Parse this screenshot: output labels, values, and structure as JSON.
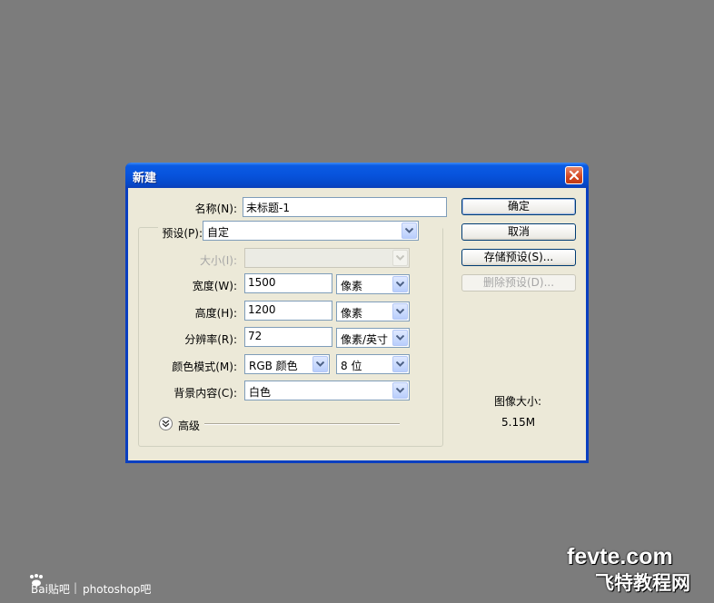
{
  "dialog": {
    "title": "新建",
    "close_icon": "close-icon"
  },
  "form": {
    "name_label": "名称(N):",
    "name_value": "未标题-1",
    "preset_label": "预设(P):",
    "preset_value": "自定",
    "size_label": "大小(I):",
    "size_value": "",
    "width_label": "宽度(W):",
    "width_value": "1500",
    "width_unit": "像素",
    "height_label": "高度(H):",
    "height_value": "1200",
    "height_unit": "像素",
    "resolution_label": "分辨率(R):",
    "resolution_value": "72",
    "resolution_unit": "像素/英寸",
    "color_mode_label": "颜色模式(M):",
    "color_mode_value": "RGB 颜色",
    "bit_depth_value": "8 位",
    "background_label": "背景内容(C):",
    "background_value": "白色",
    "advanced_label": "高级"
  },
  "buttons": {
    "ok": "确定",
    "cancel": "取消",
    "save_preset": "存储预设(S)...",
    "delete_preset": "删除预设(D)..."
  },
  "image_size": {
    "label": "图像大小:",
    "value": "5.15M"
  },
  "watermarks": {
    "baidu": "Bai贴吧",
    "separator": "|",
    "forum": "photoshop吧",
    "site": "fevte.com",
    "site_cn": "飞特教程网"
  },
  "colors": {
    "titlebar": "#0753dc",
    "dialog_face": "#ece9d8",
    "canvas_bg": "#7c7c7c",
    "close_button": "#d3461f"
  }
}
